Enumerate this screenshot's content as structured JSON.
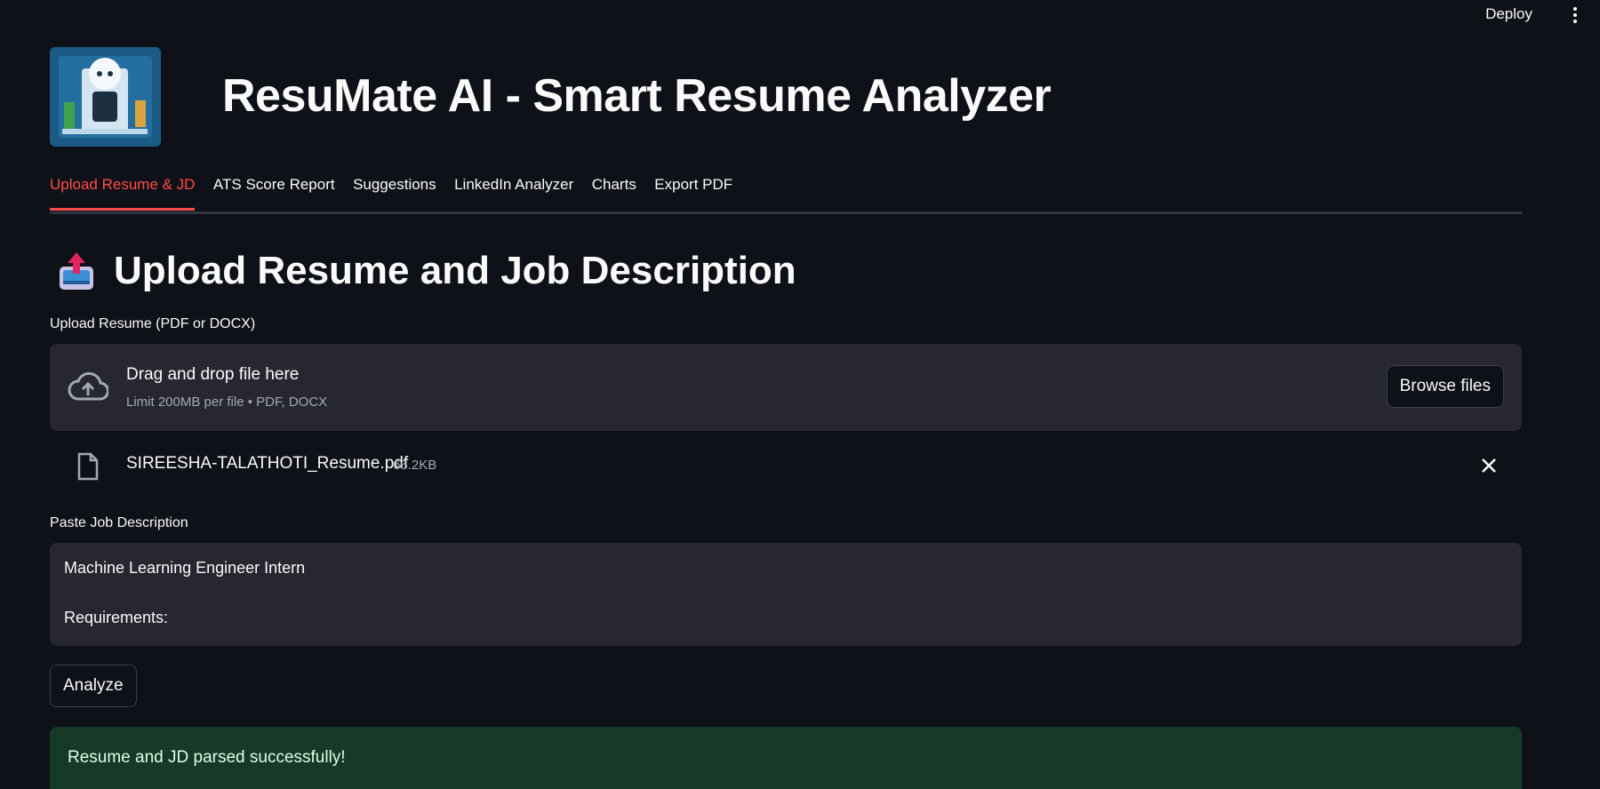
{
  "header": {
    "deploy_label": "Deploy",
    "app_title": "ResuMate AI - Smart Resume Analyzer"
  },
  "tabs": [
    {
      "label": "Upload Resume & JD",
      "active": true
    },
    {
      "label": "ATS Score Report",
      "active": false
    },
    {
      "label": "Suggestions",
      "active": false
    },
    {
      "label": "LinkedIn Analyzer",
      "active": false
    },
    {
      "label": "Charts",
      "active": false
    },
    {
      "label": "Export PDF",
      "active": false
    }
  ],
  "section": {
    "icon": "outbox-tray-icon",
    "title": "Upload Resume and Job Description"
  },
  "resume_upload": {
    "label": "Upload Resume (PDF or DOCX)",
    "dropzone_title": "Drag and drop file here",
    "dropzone_limit": "Limit 200MB per file • PDF, DOCX",
    "browse_label": "Browse files",
    "file_name": "SIREESHA-TALATHOTI_Resume.pdf",
    "file_size": "65.2KB"
  },
  "job_description": {
    "label": "Paste Job Description",
    "value": "Machine Learning Engineer Intern\n\nRequirements:"
  },
  "analyze_label": "Analyze",
  "status_message": "Resume and JD parsed successfully!",
  "colors": {
    "background": "#0e1117",
    "accent": "#ff4b4b",
    "surface": "#262730",
    "success_bg": "#173928"
  }
}
